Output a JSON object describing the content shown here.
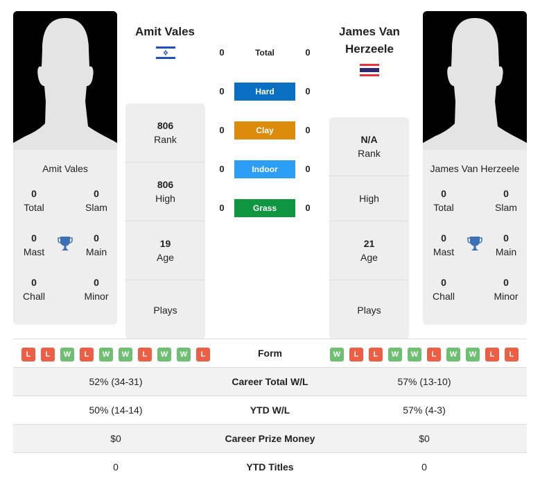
{
  "colors": {
    "hard": "#0a6fc2",
    "clay": "#dc8c0a",
    "indoor": "#2d9ef5",
    "grass": "#0e9640",
    "win": "#6fbf73",
    "loss": "#ec5f45",
    "trophy": "#3d6fb6"
  },
  "left_player": {
    "name": "Amit Vales",
    "card_name": "Amit Vales",
    "flag": "israel-flag",
    "titles": {
      "total": {
        "value": "0",
        "label": "Total"
      },
      "slam": {
        "value": "0",
        "label": "Slam"
      },
      "mast": {
        "value": "0",
        "label": "Mast"
      },
      "main": {
        "value": "0",
        "label": "Main"
      },
      "chall": {
        "value": "0",
        "label": "Chall"
      },
      "minor": {
        "value": "0",
        "label": "Minor"
      }
    },
    "stats": {
      "rank": {
        "value": "806",
        "label": "Rank"
      },
      "high": {
        "value": "806",
        "label": "High"
      },
      "age": {
        "value": "19",
        "label": "Age"
      },
      "plays": {
        "value": "",
        "label": "Plays"
      }
    }
  },
  "right_player": {
    "name": "James Van Herzeele",
    "card_name": "James Van Herzeele",
    "flag": "thailand-flag",
    "titles": {
      "total": {
        "value": "0",
        "label": "Total"
      },
      "slam": {
        "value": "0",
        "label": "Slam"
      },
      "mast": {
        "value": "0",
        "label": "Mast"
      },
      "main": {
        "value": "0",
        "label": "Main"
      },
      "chall": {
        "value": "0",
        "label": "Chall"
      },
      "minor": {
        "value": "0",
        "label": "Minor"
      }
    },
    "stats": {
      "rank": {
        "value": "N/A",
        "label": "Rank"
      },
      "high": {
        "value": "",
        "label": "High"
      },
      "age": {
        "value": "21",
        "label": "Age"
      },
      "plays": {
        "value": "",
        "label": "Plays"
      }
    }
  },
  "surfaces": [
    {
      "label": "Total",
      "left": "0",
      "right": "0",
      "style": "plain"
    },
    {
      "label": "Hard",
      "left": "0",
      "right": "0",
      "style": "hard"
    },
    {
      "label": "Clay",
      "left": "0",
      "right": "0",
      "style": "clay"
    },
    {
      "label": "Indoor",
      "left": "0",
      "right": "0",
      "style": "indoor"
    },
    {
      "label": "Grass",
      "left": "0",
      "right": "0",
      "style": "grass"
    }
  ],
  "comparison": {
    "form_label": "Form",
    "left_form": [
      "L",
      "L",
      "W",
      "L",
      "W",
      "W",
      "L",
      "W",
      "W",
      "L"
    ],
    "right_form": [
      "W",
      "L",
      "L",
      "W",
      "W",
      "L",
      "W",
      "W",
      "L",
      "L"
    ],
    "rows": [
      {
        "label": "Career Total W/L",
        "left": "52% (34-31)",
        "right": "57% (13-10)"
      },
      {
        "label": "YTD W/L",
        "left": "50% (14-14)",
        "right": "57% (4-3)"
      },
      {
        "label": "Career Prize Money",
        "left": "$0",
        "right": "$0"
      },
      {
        "label": "YTD Titles",
        "left": "0",
        "right": "0"
      }
    ]
  }
}
